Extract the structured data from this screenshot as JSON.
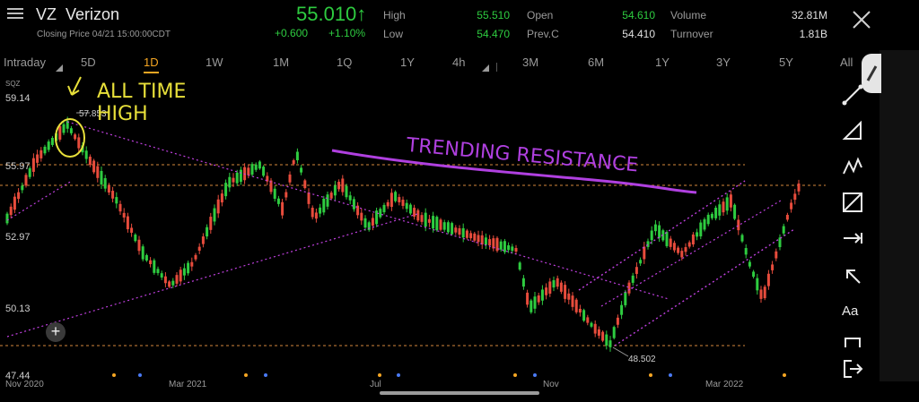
{
  "header": {
    "symbol": "VZ",
    "name": "Verizon",
    "closing_label": "Closing Price 04/21 15:00:00CDT",
    "price": "55.010",
    "change": "+0.600",
    "change_pct": "+1.10%",
    "stats": [
      {
        "label": "High",
        "value": "55.510",
        "color": "#2ecc40"
      },
      {
        "label": "Low",
        "value": "54.470",
        "color": "#2ecc40"
      },
      {
        "label": "Open",
        "value": "54.610",
        "color": "#2ecc40"
      },
      {
        "label": "Prev.C",
        "value": "54.410",
        "color": "#e0e0e0"
      },
      {
        "label": "Volume",
        "value": "32.81M",
        "color": "#e0e0e0"
      },
      {
        "label": "Turnover",
        "value": "1.81B",
        "color": "#e0e0e0"
      }
    ]
  },
  "tabs": [
    {
      "label": "Intraday",
      "dropdown": true
    },
    {
      "label": "5D"
    },
    {
      "label": "1D",
      "active": true
    },
    {
      "label": "1W"
    },
    {
      "label": "1M"
    },
    {
      "label": "1Q"
    },
    {
      "label": "1Y"
    },
    {
      "label": "4h",
      "dropdown": true
    },
    {
      "label": "3M"
    },
    {
      "label": "6M"
    },
    {
      "label": "1Y"
    },
    {
      "label": "3Y"
    },
    {
      "label": "5Y"
    },
    {
      "label": "All"
    }
  ],
  "chart_data": {
    "type": "candlestick",
    "ticker_overlay": "SQZ",
    "y_ticks": [
      "59.14",
      "55.97",
      "52.97",
      "50.13",
      "47.44"
    ],
    "x_ticks": [
      "Nov 2020",
      "Mar 2021",
      "Jul",
      "Nov",
      "Mar 2022"
    ],
    "ylim": [
      47.44,
      59.14
    ],
    "high_marker": "57.853",
    "low_marker": "48.502",
    "colors": {
      "up": "#2ecc40",
      "down": "#e74c3c",
      "td_up": "#2ecc40",
      "td_down": "#b040e0"
    }
  },
  "annotations": {
    "all_time_high": "ALL TIME HIGH",
    "trending_resistance": "TRENDING RESISTANCE"
  },
  "sidebar": {
    "tools": [
      "line-tool-icon",
      "triangle-tool-icon",
      "pattern-tool-icon",
      "fib-tool-icon",
      "horizontal-ray-icon",
      "arrow-tool-icon",
      "text-tool-icon",
      "rectangle-tool-icon",
      "exit-icon"
    ],
    "text_tool_label": "Aa"
  }
}
